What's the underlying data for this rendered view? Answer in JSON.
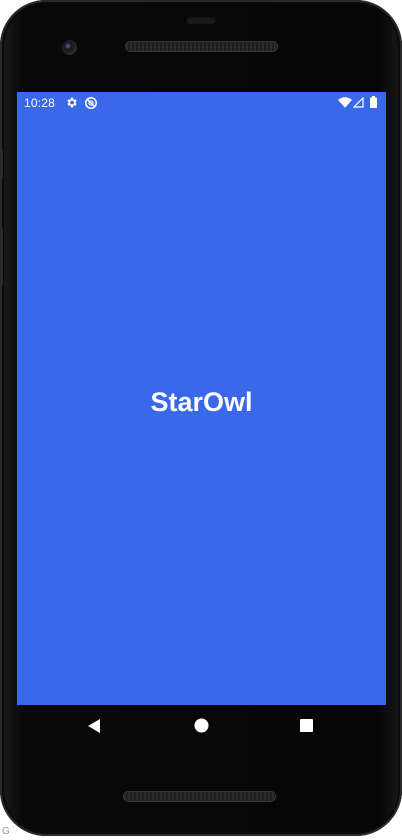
{
  "status_bar": {
    "time": "10:28",
    "left_icons": [
      "settings-gear-icon",
      "no-data-saver-icon"
    ],
    "right_icons": [
      "wifi-icon",
      "cellular-signal-icon",
      "battery-icon"
    ]
  },
  "app": {
    "title": "StarOwl",
    "background_color": "#3a68ea",
    "text_color": "#ffffff"
  },
  "navigation_bar": {
    "buttons": [
      "back",
      "home",
      "recents"
    ]
  },
  "device": {
    "frame_color": "#0b0b0b",
    "corner_text": "G"
  }
}
